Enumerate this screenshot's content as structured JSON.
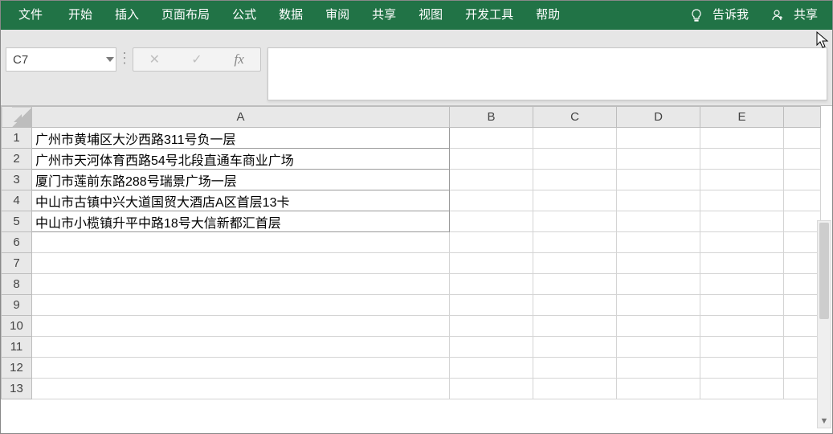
{
  "ribbon": {
    "file": "文件",
    "tabs": [
      "开始",
      "插入",
      "页面布局",
      "公式",
      "数据",
      "审阅",
      "共享",
      "视图",
      "开发工具",
      "帮助"
    ],
    "tell_me": "告诉我",
    "share": "共享"
  },
  "formula_bar": {
    "name_box": "C7",
    "fx_label": "fx",
    "formula_value": ""
  },
  "columns": [
    "A",
    "B",
    "C",
    "D",
    "E"
  ],
  "rows": [
    {
      "n": "1",
      "A": "广州市黄埔区大沙西路311号负一层"
    },
    {
      "n": "2",
      "A": "广州市天河体育西路54号北段直通车商业广场"
    },
    {
      "n": "3",
      "A": "厦门市莲前东路288号瑞景广场一层"
    },
    {
      "n": "4",
      "A": "中山市古镇中兴大道国贸大酒店A区首层13卡"
    },
    {
      "n": "5",
      "A": "中山市小榄镇升平中路18号大信新都汇首层"
    },
    {
      "n": "6",
      "A": ""
    },
    {
      "n": "7",
      "A": ""
    },
    {
      "n": "8",
      "A": ""
    },
    {
      "n": "9",
      "A": ""
    },
    {
      "n": "10",
      "A": ""
    },
    {
      "n": "11",
      "A": ""
    },
    {
      "n": "12",
      "A": ""
    },
    {
      "n": "13",
      "A": ""
    }
  ]
}
